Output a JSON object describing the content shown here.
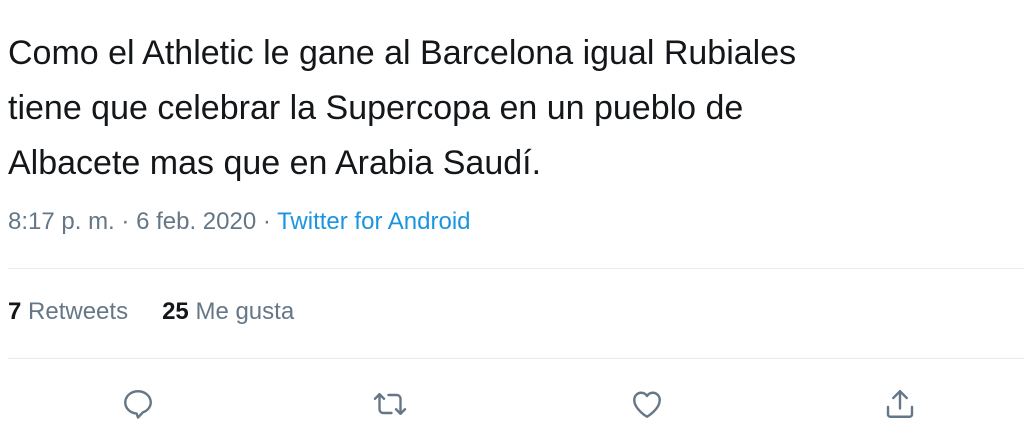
{
  "tweet": {
    "text": "Como el Athletic le gane al Barcelona igual Rubiales\ntiene que celebrar la Supercopa en un pueblo de\nAlbacete mas que en Arabia Saudí."
  },
  "meta": {
    "time": "8:17 p. m.",
    "separator1": " · ",
    "date": "6 feb. 2020",
    "separator2": " · ",
    "source": "Twitter for Android"
  },
  "stats": {
    "retweets_count": "7",
    "retweets_label": " Retweets",
    "likes_count": "25",
    "likes_label": " Me gusta"
  },
  "actions": [
    {
      "icon": "reply-icon"
    },
    {
      "icon": "retweet-icon"
    },
    {
      "icon": "heart-icon"
    },
    {
      "icon": "share-icon"
    }
  ],
  "colors": {
    "text": "#14171a",
    "secondary": "#657786",
    "link": "#1b95e0",
    "divider": "#e6ecf0"
  }
}
